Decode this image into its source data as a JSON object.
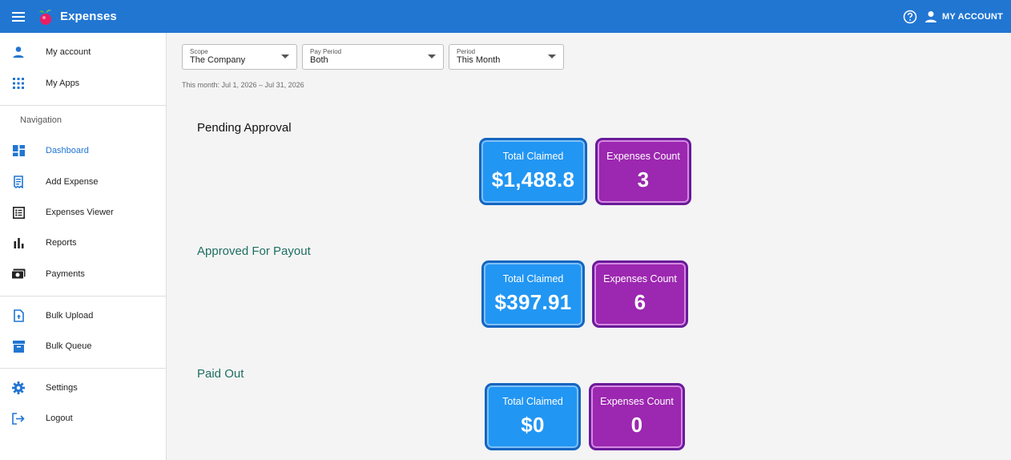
{
  "header": {
    "app_title": "Expenses",
    "account_label": "MY ACCOUNT",
    "brand_color": "#2176d2"
  },
  "sidebar": {
    "top_items": [
      {
        "label": "My account",
        "icon": "person-icon"
      },
      {
        "label": "My Apps",
        "icon": "apps-grid-icon"
      }
    ],
    "nav_heading": "Navigation",
    "nav_items": [
      {
        "label": "Dashboard",
        "icon": "dashboard-icon",
        "active": true
      },
      {
        "label": "Add Expense",
        "icon": "receipt-icon"
      },
      {
        "label": "Expenses Viewer",
        "icon": "list-icon"
      },
      {
        "label": "Reports",
        "icon": "bar-chart-icon"
      },
      {
        "label": "Payments",
        "icon": "payments-icon"
      }
    ],
    "bulk_items": [
      {
        "label": "Bulk Upload",
        "icon": "upload-file-icon"
      },
      {
        "label": "Bulk Queue",
        "icon": "archive-icon"
      }
    ],
    "bottom_items": [
      {
        "label": "Settings",
        "icon": "gear-icon"
      },
      {
        "label": "Logout",
        "icon": "logout-icon"
      }
    ]
  },
  "filters": {
    "scope": {
      "label": "Scope",
      "value": "The Company"
    },
    "pay_period": {
      "label": "Pay Period",
      "value": "Both"
    },
    "period": {
      "label": "Period",
      "value": "This Month"
    },
    "note": "This month: Jul 1, 2026 – Jul 31, 2026"
  },
  "sections": [
    {
      "title": "Pending Approval",
      "total_label": "Total Claimed",
      "total_value": "$1,488.8",
      "count_label": "Expenses Count",
      "count_value": "3"
    },
    {
      "title": "Approved For Payout",
      "total_label": "Total Claimed",
      "total_value": "$397.91",
      "count_label": "Expenses Count",
      "count_value": "6"
    },
    {
      "title": "Paid Out",
      "total_label": "Total Claimed",
      "total_value": "$0",
      "count_label": "Expenses Count",
      "count_value": "0"
    }
  ],
  "colors": {
    "total_card": "#2296f3",
    "count_card": "#9c27b0",
    "section_teal": "#1f6e62"
  }
}
